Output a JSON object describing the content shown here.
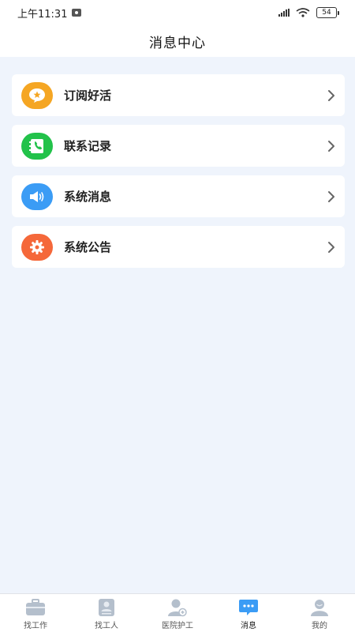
{
  "status_bar": {
    "time": "上午11:31",
    "battery": "54"
  },
  "header": {
    "title": "消息中心"
  },
  "menu": {
    "items": [
      {
        "label": "订阅好活",
        "icon": "star-bubble-icon",
        "color": "#f5a623"
      },
      {
        "label": "联系记录",
        "icon": "phone-book-icon",
        "color": "#22c24a"
      },
      {
        "label": "系统消息",
        "icon": "speaker-icon",
        "color": "#3b9cf5"
      },
      {
        "label": "系统公告",
        "icon": "gear-icon",
        "color": "#f5683a"
      }
    ]
  },
  "tabbar": {
    "active_index": 3,
    "items": [
      {
        "label": "找工作",
        "icon": "briefcase-icon"
      },
      {
        "label": "找工人",
        "icon": "worker-card-icon"
      },
      {
        "label": "医院护工",
        "icon": "nurse-icon"
      },
      {
        "label": "消息",
        "icon": "chat-bubble-icon"
      },
      {
        "label": "我的",
        "icon": "profile-icon"
      }
    ]
  }
}
